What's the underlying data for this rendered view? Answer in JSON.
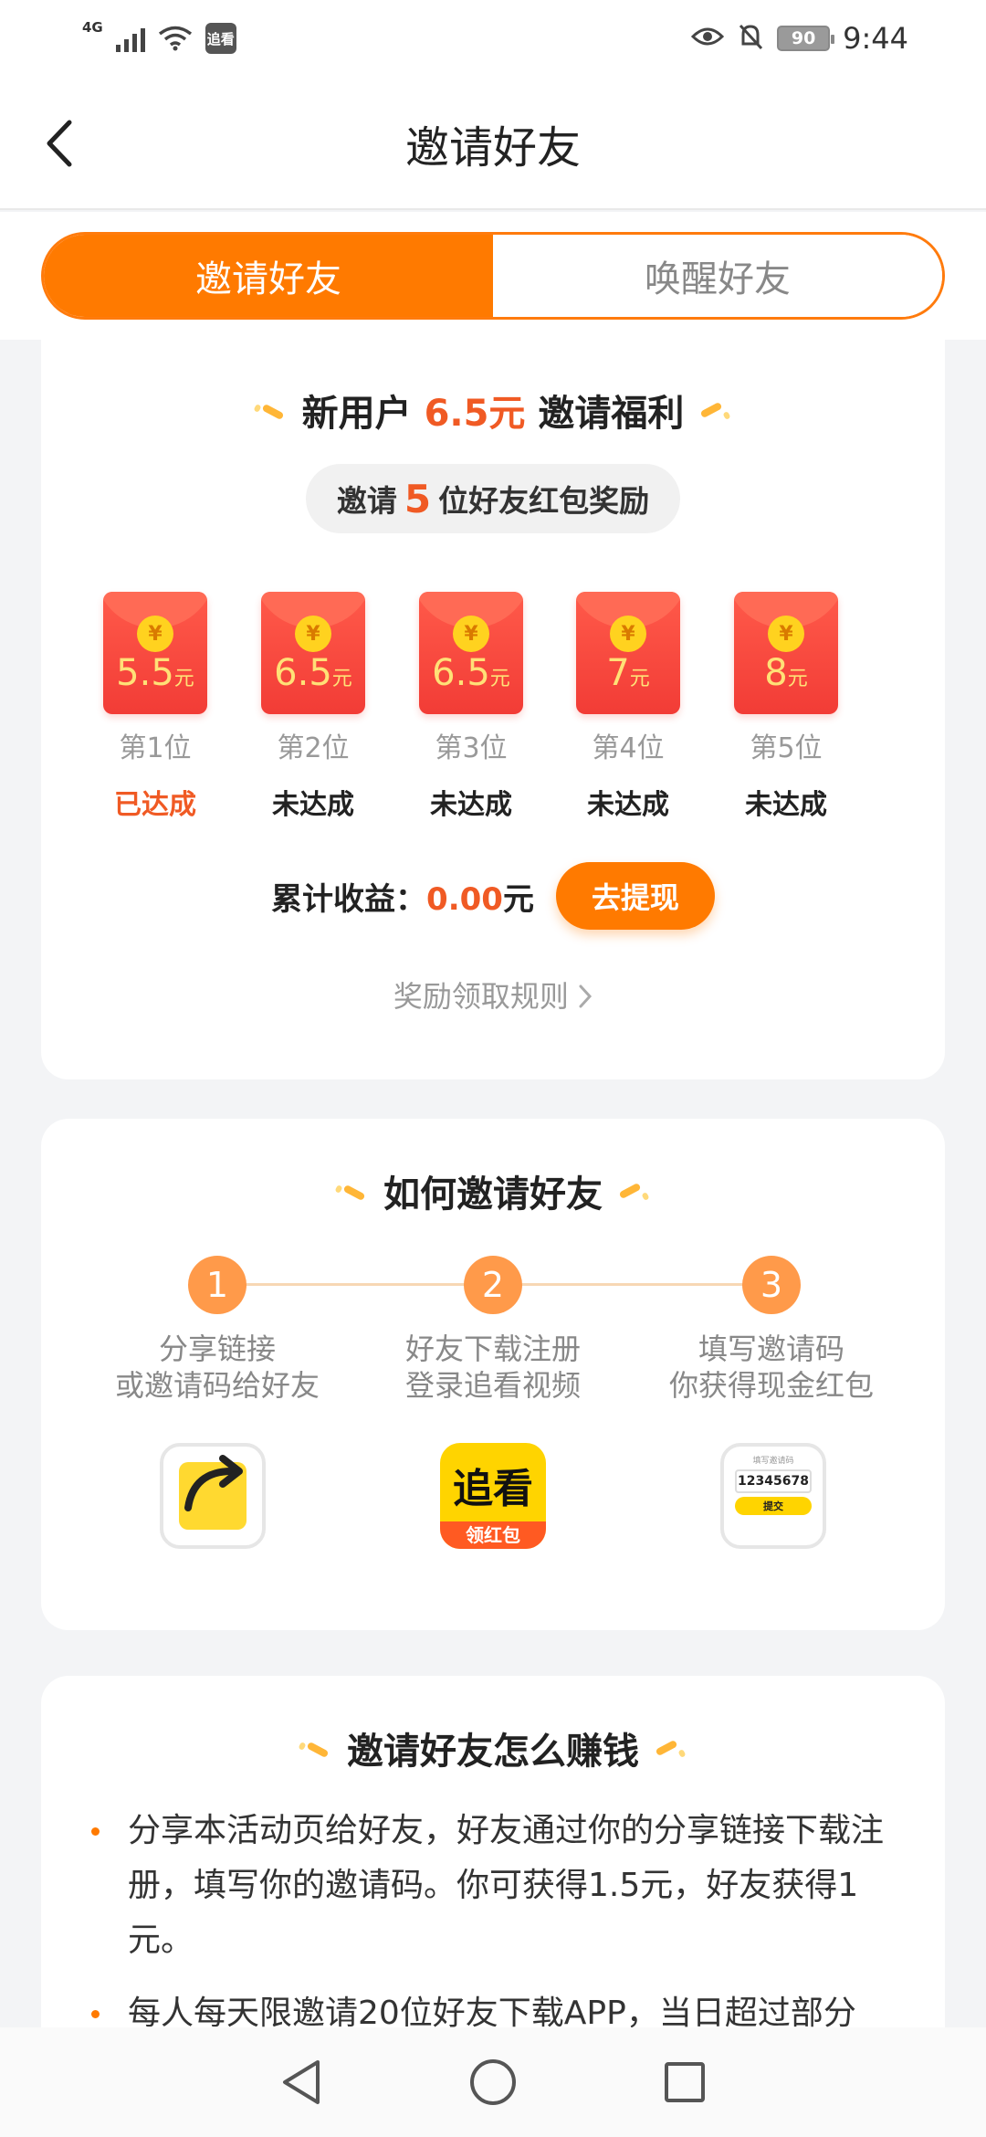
{
  "status_bar": {
    "network": "4G",
    "app_badge": "追看",
    "battery": "90",
    "time": "9:44"
  },
  "nav": {
    "title": "邀请好友"
  },
  "tabs": [
    {
      "label": "邀请好友",
      "active": true
    },
    {
      "label": "唤醒好友",
      "active": false
    }
  ],
  "welfare": {
    "title_pre": "新用户",
    "title_amount": "6.5元",
    "title_post": "邀请福利",
    "invite_pre": "邀请",
    "invite_count": "5",
    "invite_post": "位好友红包奖励",
    "currency_symbol": "¥",
    "unit": "元",
    "rewards": [
      {
        "amount": "5.5",
        "rank": "第1位",
        "state": "已达成",
        "done": true
      },
      {
        "amount": "6.5",
        "rank": "第2位",
        "state": "未达成",
        "done": false
      },
      {
        "amount": "6.5",
        "rank": "第3位",
        "state": "未达成",
        "done": false
      },
      {
        "amount": "7",
        "rank": "第4位",
        "state": "未达成",
        "done": false
      },
      {
        "amount": "8",
        "rank": "第5位",
        "state": "未达成",
        "done": false
      }
    ],
    "earn_label": "累计收益：",
    "earn_value": "0.00",
    "earn_unit": "元",
    "withdraw_button": "去提现",
    "rules_link": "奖励领取规则"
  },
  "how_to": {
    "title": "如何邀请好友",
    "steps": [
      {
        "num": "1",
        "line1": "分享链接",
        "line2": "或邀请码给好友"
      },
      {
        "num": "2",
        "line1": "好友下载注册",
        "line2": "登录追看视频"
      },
      {
        "num": "3",
        "line1": "填写邀请码",
        "line2": "你获得现金红包"
      }
    ],
    "app_icon_brand": "追看",
    "app_icon_ribbon": "领红包",
    "form_label": "填写邀请码",
    "form_code": "12345678",
    "form_submit": "提交"
  },
  "earn_money": {
    "title": "邀请好友怎么赚钱",
    "bullets": [
      "分享本活动页给好友，好友通过你的分享链接下载注册，填写你的邀请码。你可获得1.5元，好友获得1元。",
      "每人每天限邀请20位好友下载APP，当日超过部分"
    ]
  },
  "colors": {
    "brand_orange": "#ff7a00",
    "accent_red": "#f05a24",
    "envelope_red": "#f23c36"
  }
}
